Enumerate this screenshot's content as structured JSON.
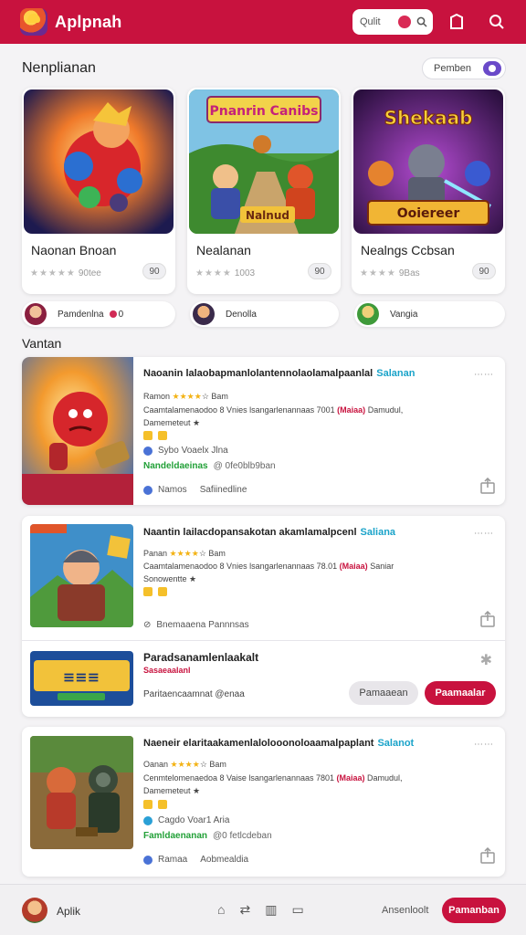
{
  "header": {
    "app_title": "Aplpnah",
    "search_placeholder": "Qulit",
    "icons": [
      "app-logo-icon",
      "bookmark-icon",
      "search-icon"
    ]
  },
  "featured": {
    "section_title": "Nenplianan",
    "toggle_label": "Pemben",
    "cards": [
      {
        "name": "Naonan Bnoan",
        "rating_text": "90tee",
        "count": "90"
      },
      {
        "name": "Nealanan",
        "rating_text": "1003",
        "count": "90",
        "art_title": "Pnanrin Canibs",
        "art_subtitle": "Nalnud"
      },
      {
        "name": "Nealngs Ccbsan",
        "rating_text": "9Bas",
        "count": "90",
        "art_title": "Shekaab",
        "art_subtitle": "Ooiereer"
      }
    ],
    "developers": [
      {
        "label": "Pamdenlna",
        "extra": "0"
      },
      {
        "label": "Denolla"
      },
      {
        "label": "Vangia"
      }
    ]
  },
  "list": {
    "section_title": "Vantan",
    "items": [
      {
        "title": "Naoanin lalaobapmanlolantennolaolamalpaanlal",
        "tag": "Salanan",
        "meta": "Ramon",
        "meta_extra": "Bam",
        "desc_a": "Caamtalamenaodoo 8 Vnies lsangarlenannaas 7001",
        "desc_red": "(Maiaa)",
        "desc_b": "Damudul,",
        "desc_c": "Damemeteut",
        "dev": "Sybo Voaelx Jlna",
        "green": "Nandeldaeinas",
        "green_extra": "@ 0fe0blb9ban",
        "foot_a": "Namos",
        "foot_b": "Safiinedline"
      },
      {
        "title": "Naantin lailacdopansakotan akamlamalpcenl",
        "tag": "Saliana",
        "meta": "Panan",
        "meta_extra": "Bam",
        "desc_a": "Caamtalamenaodoo 8 Vnies lsangarlenannaas 78.01",
        "desc_red": "(Maiaa)",
        "desc_b": "Saniar",
        "desc_c": "Sonowentte",
        "foot": "Bnemaaena Pannnsas"
      }
    ],
    "nested": {
      "title": "Paradsanamlenlaakalt",
      "subtitle": "Sasaeaalanl",
      "dev_line": "Paritaencaamnat",
      "dev_extra": "@enaa",
      "btn_grey": "Pamaaean",
      "btn_red": "Paamaalar"
    },
    "item3": {
      "title": "Naeneir elaritaakamenlalolooonoloaamalpaplant",
      "tag": "Salanot",
      "meta": "Oanan",
      "meta_extra": "Bam",
      "desc_a": "Cenmtelomenaedoa 8 Vaise lsangarlenannaas 7801",
      "desc_red": "(Maiaa)",
      "desc_b": "Damudul,",
      "desc_c": "Damemeteut",
      "dev": "Cagdo Voar1 Aria",
      "green": "Famldaenanan",
      "green_extra": "@0 fetlcdeban",
      "foot_a": "Ramaa",
      "foot_b": "Aobmealdia"
    }
  },
  "bottom_bar": {
    "label": "Aplik",
    "nav_icons": [
      "home-icon",
      "arrows-icon",
      "map-icon",
      "edit-icon"
    ],
    "text": "Ansenloolt",
    "cta": "Pamanban"
  },
  "colors": {
    "brand": "#c8123e",
    "accent_blue": "#1aa3c9",
    "green": "#21a037",
    "star": "#f3b316"
  }
}
